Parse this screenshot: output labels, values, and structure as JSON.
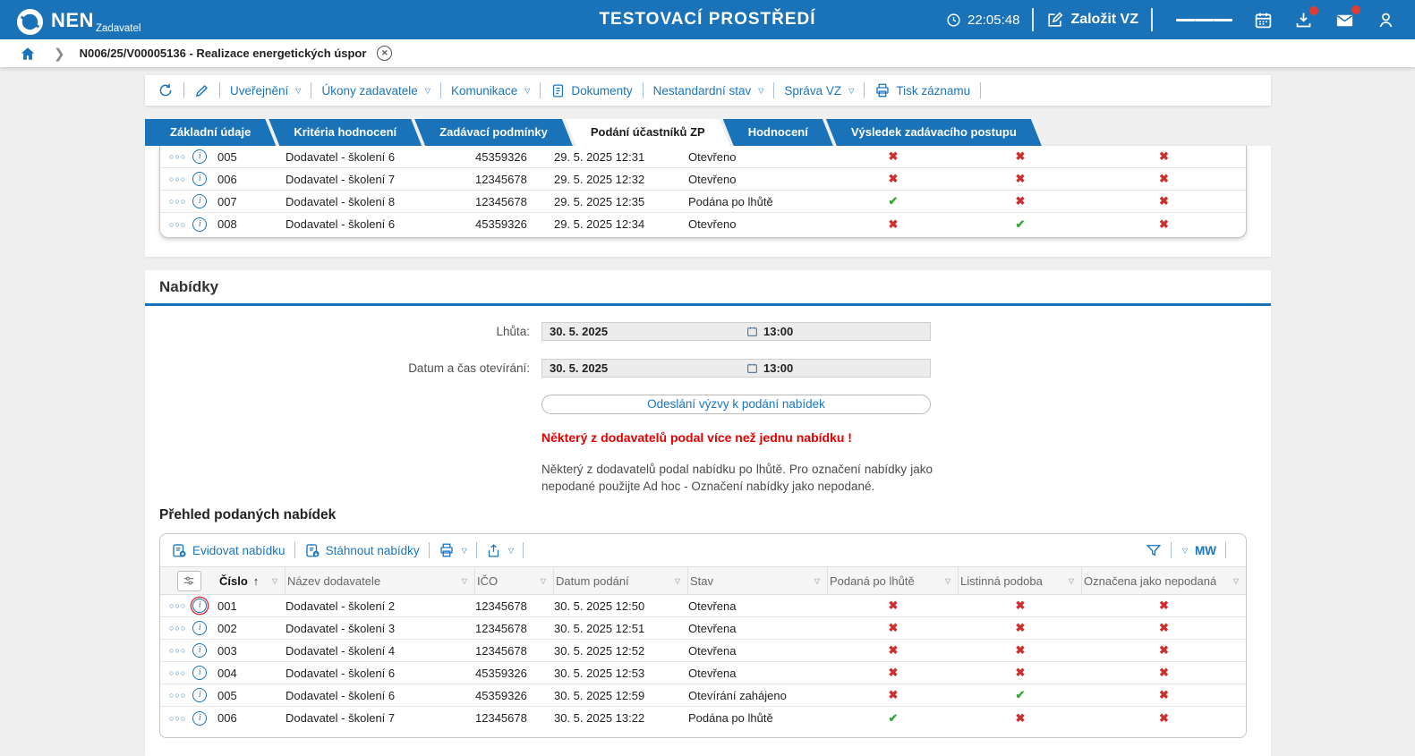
{
  "colors": {
    "accent": "#1a72b8",
    "link": "#1b75bd",
    "red": "#cf2e2e",
    "green": "#35a83a",
    "warning_red": "#e60000"
  },
  "header": {
    "brand": "NEN",
    "brand_sub": "Zadavatel",
    "env_title": "TESTOVACÍ PROSTŘEDÍ",
    "time": "22:05:48",
    "create_button": "Založit VZ"
  },
  "breadcrumb": {
    "path": "N006/25/V00005136 - Realizace energetických úspor"
  },
  "record_toolbar": {
    "menus": [
      {
        "label": "Uveřejnění",
        "icon": "",
        "dropdown": true
      },
      {
        "label": "Úkony zadavatele",
        "icon": "",
        "dropdown": true
      },
      {
        "label": "Komunikace",
        "icon": "",
        "dropdown": true
      },
      {
        "label": "Dokumenty",
        "icon": "document",
        "dropdown": false
      },
      {
        "label": "Nestandardní stav",
        "icon": "",
        "dropdown": true
      },
      {
        "label": "Správa VZ",
        "icon": "",
        "dropdown": true
      },
      {
        "label": "Tisk záznamu",
        "icon": "printer",
        "dropdown": false
      }
    ]
  },
  "tabs": [
    {
      "label": "Základní údaje",
      "active": false
    },
    {
      "label": "Kritéria hodnocení",
      "active": false
    },
    {
      "label": "Zadávací podmínky",
      "active": false
    },
    {
      "label": "Podání účastníků ZP",
      "active": true
    },
    {
      "label": "Hodnocení",
      "active": false
    },
    {
      "label": "Výsledek zadávacího postupu",
      "active": false
    }
  ],
  "participants_table": {
    "rows": [
      {
        "num": "005",
        "supplier": "Dodavatel - školení 6",
        "ico": "45359326",
        "date": "29. 5. 2025 12:31",
        "status": "Otevřeno",
        "late": "x",
        "paper": "x",
        "unsubmitted": "x",
        "focused": false
      },
      {
        "num": "006",
        "supplier": "Dodavatel - školení 7",
        "ico": "12345678",
        "date": "29. 5. 2025 12:32",
        "status": "Otevřeno",
        "late": "x",
        "paper": "x",
        "unsubmitted": "x",
        "focused": false
      },
      {
        "num": "007",
        "supplier": "Dodavatel - školení 8",
        "ico": "12345678",
        "date": "29. 5. 2025 12:35",
        "status": "Podána po lhůtě",
        "late": "check",
        "paper": "x",
        "unsubmitted": "x",
        "focused": false
      },
      {
        "num": "008",
        "supplier": "Dodavatel - školení 6",
        "ico": "45359326",
        "date": "29. 5. 2025 12:34",
        "status": "Otevřeno",
        "late": "x",
        "paper": "check",
        "unsubmitted": "x",
        "focused": false
      }
    ]
  },
  "offers_section": {
    "title": "Nabídky",
    "fields": [
      {
        "label": "Lhůta:",
        "date": "30. 5. 2025",
        "time": "13:00"
      },
      {
        "label": "Datum a čas otevírání:",
        "date": "30. 5. 2025",
        "time": "13:00"
      }
    ],
    "send_button": "Odeslání výzvy k podání nabídek",
    "warning": "Některý z dodavatelů podal více než jednu nabídku !",
    "note": "Některý z dodavatelů podal nabídku po lhůtě. Pro označení nabídky jako nepodané použijte Ad hoc - Označení nabídky jako nepodané.",
    "list_title": "Přehled podaných nabídek",
    "toolbar": {
      "register": "Evidovat nabídku",
      "download": "Stáhnout nabídky",
      "mw": "MW"
    },
    "columns": [
      {
        "label": "Číslo",
        "sorted": true
      },
      {
        "label": "Název dodavatele",
        "sorted": false
      },
      {
        "label": "IČO",
        "sorted": false
      },
      {
        "label": "Datum podání",
        "sorted": false
      },
      {
        "label": "Stav",
        "sorted": false
      },
      {
        "label": "Podaná po lhůtě",
        "sorted": false
      },
      {
        "label": "Listinná podoba",
        "sorted": false
      },
      {
        "label": "Označena jako nepodaná",
        "sorted": false
      }
    ],
    "rows": [
      {
        "num": "001",
        "supplier": "Dodavatel - školení 2",
        "ico": "12345678",
        "date": "30. 5. 2025 12:50",
        "status": "Otevřena",
        "late": "x",
        "paper": "x",
        "unsubmitted": "x",
        "focused": true
      },
      {
        "num": "002",
        "supplier": "Dodavatel - školení 3",
        "ico": "12345678",
        "date": "30. 5. 2025 12:51",
        "status": "Otevřena",
        "late": "x",
        "paper": "x",
        "unsubmitted": "x",
        "focused": false
      },
      {
        "num": "003",
        "supplier": "Dodavatel - školení 4",
        "ico": "12345678",
        "date": "30. 5. 2025 12:52",
        "status": "Otevřena",
        "late": "x",
        "paper": "x",
        "unsubmitted": "x",
        "focused": false
      },
      {
        "num": "004",
        "supplier": "Dodavatel - školení 6",
        "ico": "45359326",
        "date": "30. 5. 2025 12:53",
        "status": "Otevřena",
        "late": "x",
        "paper": "x",
        "unsubmitted": "x",
        "focused": false
      },
      {
        "num": "005",
        "supplier": "Dodavatel - školení 6",
        "ico": "45359326",
        "date": "30. 5. 2025 12:59",
        "status": "Otevírání zahájeno",
        "late": "x",
        "paper": "check",
        "unsubmitted": "x",
        "focused": false
      },
      {
        "num": "006",
        "supplier": "Dodavatel - školení 7",
        "ico": "12345678",
        "date": "30. 5. 2025 13:22",
        "status": "Podána po lhůtě",
        "late": "check",
        "paper": "x",
        "unsubmitted": "x",
        "focused": false
      }
    ]
  }
}
